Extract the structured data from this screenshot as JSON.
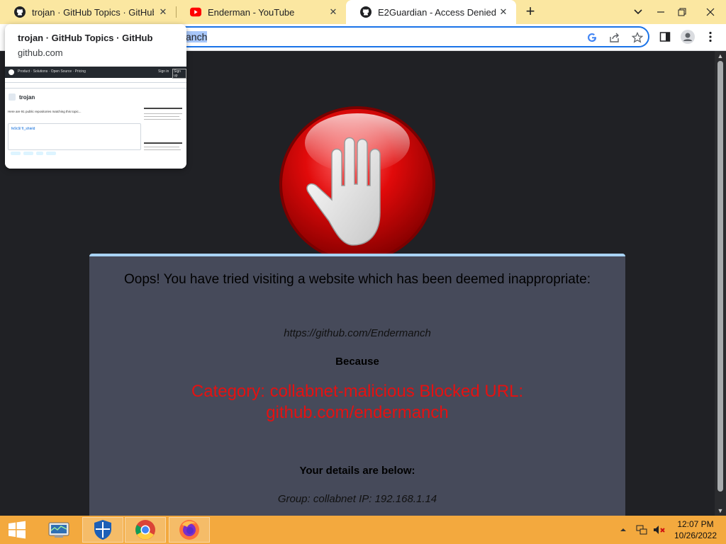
{
  "browser": {
    "tabs": [
      {
        "label": "trojan · GitHub Topics · GitHub",
        "icon": "github-icon",
        "active": false
      },
      {
        "label": "Enderman - YouTube",
        "icon": "youtube-icon",
        "active": false
      },
      {
        "label": "E2Guardian - Access Denied",
        "icon": "github-icon",
        "active": true
      }
    ],
    "new_tab_label": "+",
    "address_bar": {
      "visible_text": "anch"
    },
    "window_controls": [
      "chevron-down-icon",
      "minimize-icon",
      "restore-icon",
      "close-icon"
    ]
  },
  "hover_card": {
    "title": "trojan · GitHub Topics · GitHub",
    "domain": "github.com",
    "thumbnail": {
      "nav": [
        "Product",
        "Solutions",
        "Open Source",
        "Pricing"
      ],
      "sign_in": "Sign in",
      "sign_up": "Sign up",
      "topic": "trojan",
      "summary": "Here are 91 public repositories matching this topic...",
      "repo": "fe9c9/ fi_shield"
    }
  },
  "page": {
    "heading": "Oops! You have tried visiting a website which has been deemed inappropriate:",
    "url": "https://github.com/Endermanch",
    "because": "Because",
    "reason": "Category: collabnet-malicious  Blocked URL: github.com/endermanch",
    "details_heading": "Your details are below:",
    "details": "Group: collabnet   IP: 192.168.1.14"
  },
  "colors": {
    "tabstrip": "#fbe7a1",
    "taskbar": "#f3a93e",
    "panel": "#464a5a",
    "panel_border": "#a9d3f5",
    "reason_text": "#e51111",
    "omnibox_focus": "#1a73e8"
  },
  "taskbar": {
    "items": [
      "start-icon",
      "task-manager-icon",
      "windows-defender-icon",
      "chrome-icon",
      "firefox-icon"
    ],
    "tray": [
      "show-hidden-icons-icon",
      "network-icon",
      "volume-muted-icon"
    ],
    "time": "12:07 PM",
    "date": "10/26/2022"
  }
}
